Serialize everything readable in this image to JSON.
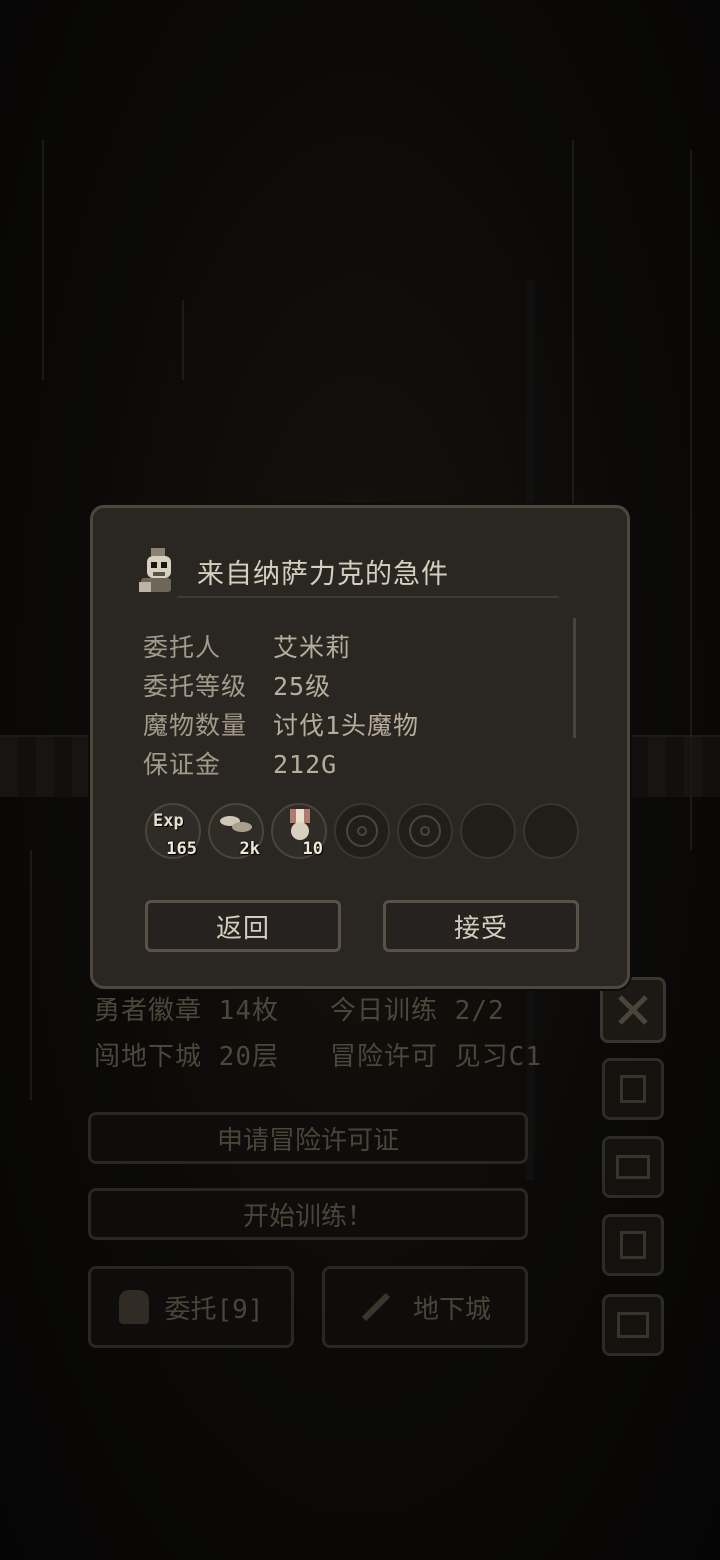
{
  "dialog": {
    "title": "来自纳萨力克的急件",
    "rows": [
      {
        "label": "委托人",
        "value": "艾米莉"
      },
      {
        "label": "委托等级",
        "value": "25级"
      },
      {
        "label": "魔物数量",
        "value": "讨伐1头魔物"
      },
      {
        "label": "保证金",
        "value": "212G"
      }
    ],
    "rewards": [
      {
        "icon": "exp-icon",
        "label": "Exp",
        "amount": "165"
      },
      {
        "icon": "coins-icon",
        "label": "",
        "amount": "2k"
      },
      {
        "icon": "medal-icon",
        "label": "",
        "amount": "10"
      },
      {
        "icon": "empty-ring-icon",
        "label": "",
        "amount": ""
      },
      {
        "icon": "empty-ring-icon",
        "label": "",
        "amount": ""
      },
      {
        "icon": "empty-slot",
        "label": "",
        "amount": ""
      },
      {
        "icon": "empty-slot",
        "label": "",
        "amount": ""
      }
    ],
    "back_label": "返回",
    "accept_label": "接受"
  },
  "status": {
    "badge_label": "勇者徽章",
    "badge_value": "14枚",
    "training_label": "今日训练",
    "training_value": "2/2",
    "dungeon_label": "闯地下城",
    "dungeon_value": "20层",
    "permit_label": "冒险许可",
    "permit_value": "见习C1"
  },
  "actions": {
    "apply_permit": "申请冒险许可证",
    "start_training": "开始训练！",
    "commission": "委托[9]",
    "dungeon": "地下城"
  },
  "side_menu": [
    "sword-icon",
    "scroll-icon",
    "map-icon",
    "book-icon",
    "computer-icon"
  ],
  "colors": {
    "panel": "#2a2621",
    "border": "#4e473e",
    "text": "#d6cfc0"
  }
}
